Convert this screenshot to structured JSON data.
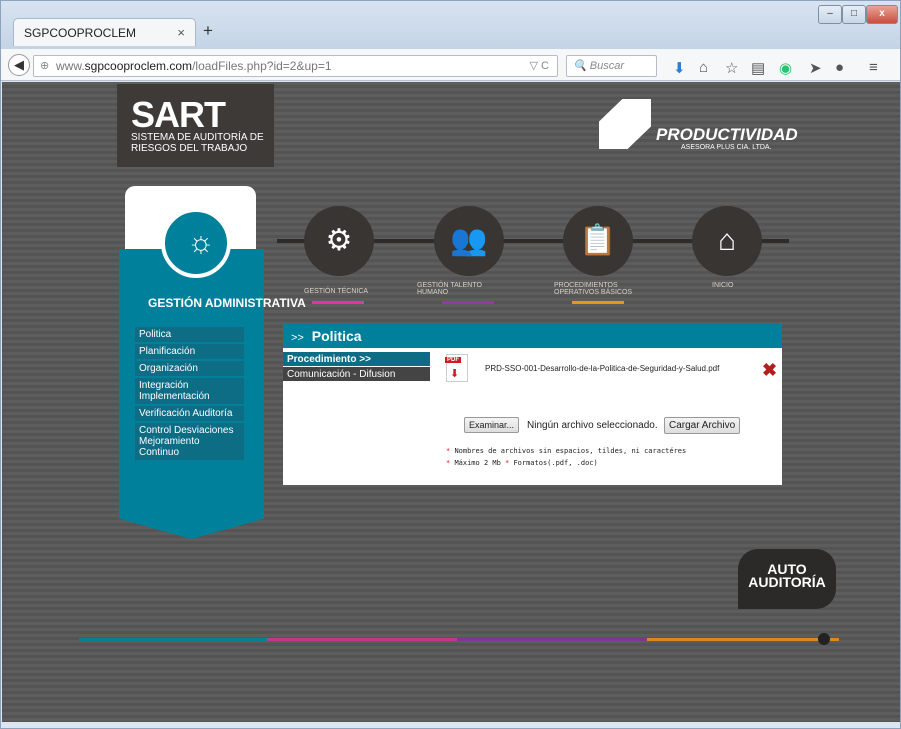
{
  "browser": {
    "tab_title": "SGPCOOPROCLEM",
    "tab_close": "×",
    "new_tab": "+",
    "url_prefix": "www.",
    "url_host": "sgpcooproclem.com",
    "url_path": "/loadFiles.php?id=2&up=1",
    "search_placeholder": "Buscar",
    "window_buttons": [
      "–",
      "□",
      "x"
    ]
  },
  "header": {
    "sart_title": "SART",
    "sart_subtitle": "SISTEMA DE AUDITORÍA DE RIESGOS DEL TRABAJO",
    "brand_name": "PRODUCTIVIDAD",
    "brand_tagline": "ASESORA PLUS CIA. LTDA."
  },
  "left_panel": {
    "title": "GESTIÓN ADMINISTRATIVA",
    "items": [
      {
        "label": "Politica"
      },
      {
        "label": "Planificación"
      },
      {
        "label": "Organización"
      },
      {
        "label": "Integración Implementación"
      },
      {
        "label": "Verificación Auditoría"
      },
      {
        "label": "Control Desviaciones Mejoramiento Continuo"
      }
    ]
  },
  "steps": [
    {
      "label": "GESTIÓN TÉCNICA",
      "color": "#e0389a"
    },
    {
      "label": "GESTIÓN TALENTO HUMANO",
      "color": "#8e3aa8"
    },
    {
      "label": "PROCEDIMIENTOS OPERATIVOS BÁSICOS",
      "color": "#e8951a"
    },
    {
      "label": "INICIO",
      "color": ""
    }
  ],
  "content": {
    "header_arrows": ">>",
    "header_title": "Politica",
    "nav": [
      {
        "label": "Procedimiento >>"
      },
      {
        "label": "Comunicación - Difusion"
      }
    ],
    "file_name": "PRD-SSO-001-Desarrollo-de-la-Politica-de-Seguridad-y-Salud.pdf",
    "pdf_tag": "PDF",
    "delete_symbol": "✖",
    "browse_button": "Examinar...",
    "no_file_text": "Ningún archivo seleccionado.",
    "upload_button": "Cargar Archivo",
    "note_1": "Nombres de archivos sin espacios, tildes, ni caractéres",
    "note_2a": "Máximo 2 Mb",
    "note_2b": "Formatos(.pdf, .doc)",
    "asterisk": "*"
  },
  "auto_audit": {
    "line1": "AUTO",
    "line2": "AUDITORÍA"
  },
  "colors": {
    "teal": "#00809b",
    "magenta": "#e0389a",
    "purple": "#8e3aa8",
    "orange": "#e8951a",
    "dark": "#2b2a29"
  }
}
